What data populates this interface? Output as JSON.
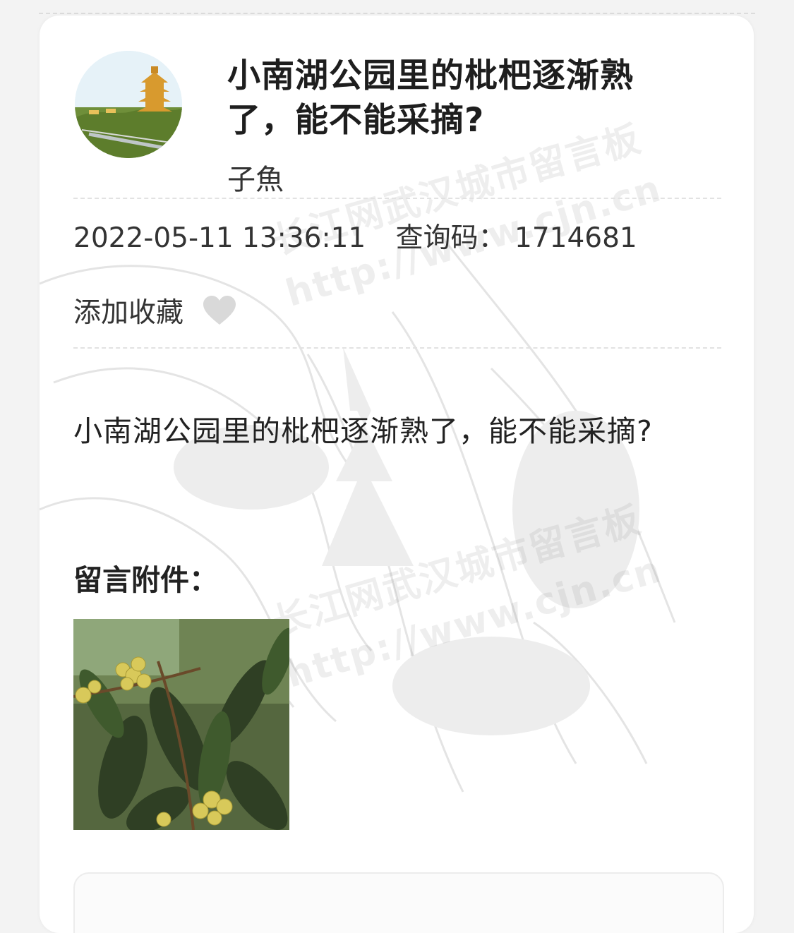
{
  "post": {
    "title": "小南湖公园里的枇杷逐渐熟了，能不能采摘?",
    "author": "子魚",
    "datetime": "2022-05-11 13:36:11",
    "query_code_label": "查询码：",
    "query_code": "1714681",
    "favorite_label": "添加收藏",
    "content": "小南湖公园里的枇杷逐渐熟了，能不能采摘?",
    "attachments_label": "留言附件："
  },
  "watermark": {
    "line1": "长江网武汉城市留言板",
    "line2": "http://www.cjn.cn"
  },
  "icons": {
    "favorite": "heart-icon",
    "avatar": "yellow-crane-tower-avatar"
  },
  "colors": {
    "heart": "#d9d9d9",
    "background": "#f3f3f3",
    "card": "#ffffff"
  }
}
